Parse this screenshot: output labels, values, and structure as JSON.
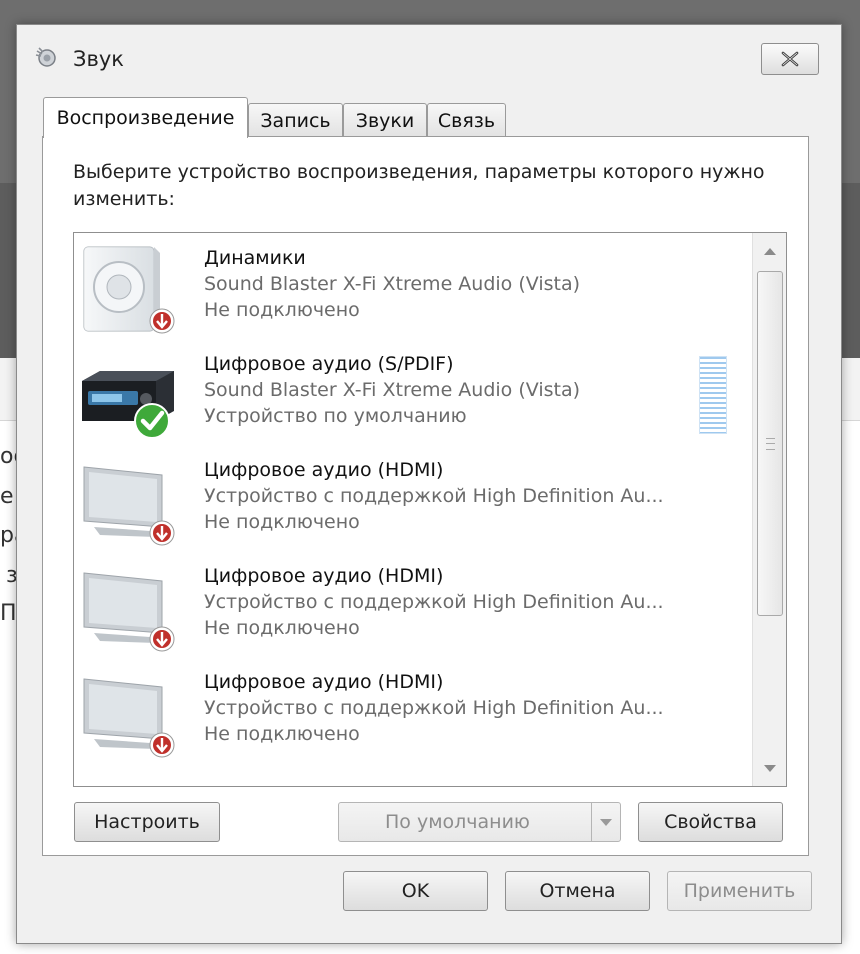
{
  "background_fragments": [
    "ос",
    "е",
    "ра",
    "з",
    "Пе"
  ],
  "dialog": {
    "title": "Звук",
    "close_icon": "close-icon"
  },
  "tabs": [
    {
      "label": "Воспроизведение",
      "active": true
    },
    {
      "label": "Запись",
      "active": false
    },
    {
      "label": "Звуки",
      "active": false
    },
    {
      "label": "Связь",
      "active": false
    }
  ],
  "playback": {
    "instruction": "Выберите устройство воспроизведения, параметры которого нужно изменить:",
    "devices": [
      {
        "name": "Динамики",
        "description": "Sound Blaster X-Fi Xtreme Audio (Vista)",
        "status": "Не подключено",
        "icon": "speaker-icon",
        "badge": "disconnected-badge-icon"
      },
      {
        "name": "Цифровое аудио (S/PDIF)",
        "description": "Sound Blaster X-Fi Xtreme Audio (Vista)",
        "status": "Устройство по умолчанию",
        "icon": "receiver-icon",
        "badge": "default-check-icon"
      },
      {
        "name": "Цифровое аудио (HDMI)",
        "description": "Устройство с поддержкой High Definition Au...",
        "status": "Не подключено",
        "icon": "monitor-icon",
        "badge": "disconnected-badge-icon"
      },
      {
        "name": "Цифровое аудио (HDMI)",
        "description": "Устройство с поддержкой High Definition Au...",
        "status": "Не подключено",
        "icon": "monitor-icon",
        "badge": "disconnected-badge-icon"
      },
      {
        "name": "Цифровое аудио (HDMI)",
        "description": "Устройство с поддержкой High Definition Au...",
        "status": "Не подключено",
        "icon": "monitor-icon",
        "badge": "disconnected-badge-icon"
      }
    ],
    "configure_label": "Настроить",
    "default_label": "По умолчанию",
    "properties_label": "Свойства"
  },
  "footer": {
    "ok_label": "OK",
    "cancel_label": "Отмена",
    "apply_label": "Применить"
  },
  "colors": {
    "dialog_bg": "#f0f0f0",
    "panel_bg": "#ffffff",
    "disabled_text": "#8d8d8d",
    "badge_red": "#c0302b",
    "check_green": "#3fa93a"
  }
}
